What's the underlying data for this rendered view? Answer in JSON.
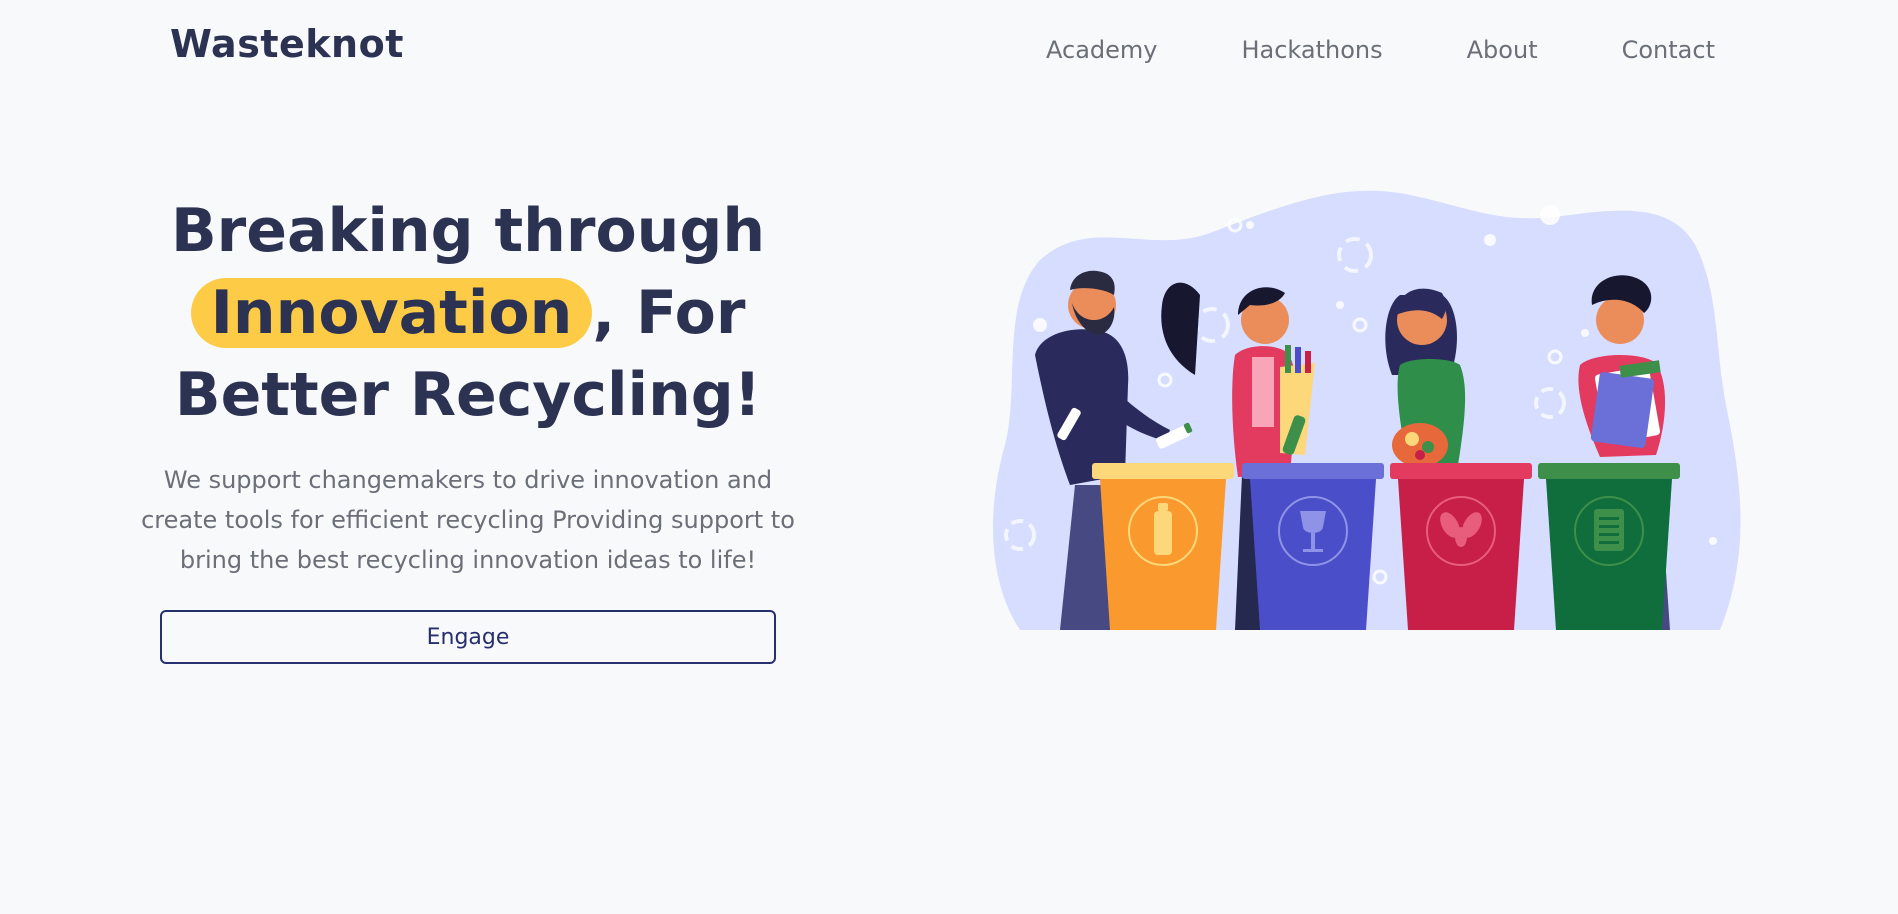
{
  "header": {
    "brand": "Wasteknot",
    "nav": [
      "Academy",
      "Hackathons",
      "About",
      "Contact"
    ]
  },
  "hero": {
    "headline_line1": "Breaking through",
    "headline_highlight": "Innovation",
    "headline_after_highlight": ", For",
    "headline_line3": "Better Recycling!",
    "description": "We support changemakers to drive innovation and create tools for efficient recycling Providing support to bring the best recycling innovation ideas to life!",
    "cta_label": "Engage"
  },
  "colors": {
    "background": "#f8f9fb",
    "text_dark": "#2c3252",
    "text_muted": "#6a6f78",
    "highlight": "#fecb47",
    "button_border": "#27306e",
    "blob": "#d6ddff",
    "bin_orange": "#fa9a2e",
    "bin_blue": "#4a4ec8",
    "bin_red": "#c71f47",
    "bin_green": "#0f6e3c"
  },
  "illustration": {
    "bin_icons": [
      "bottle-icon",
      "glass-icon",
      "leaf-icon",
      "paper-icon"
    ]
  }
}
